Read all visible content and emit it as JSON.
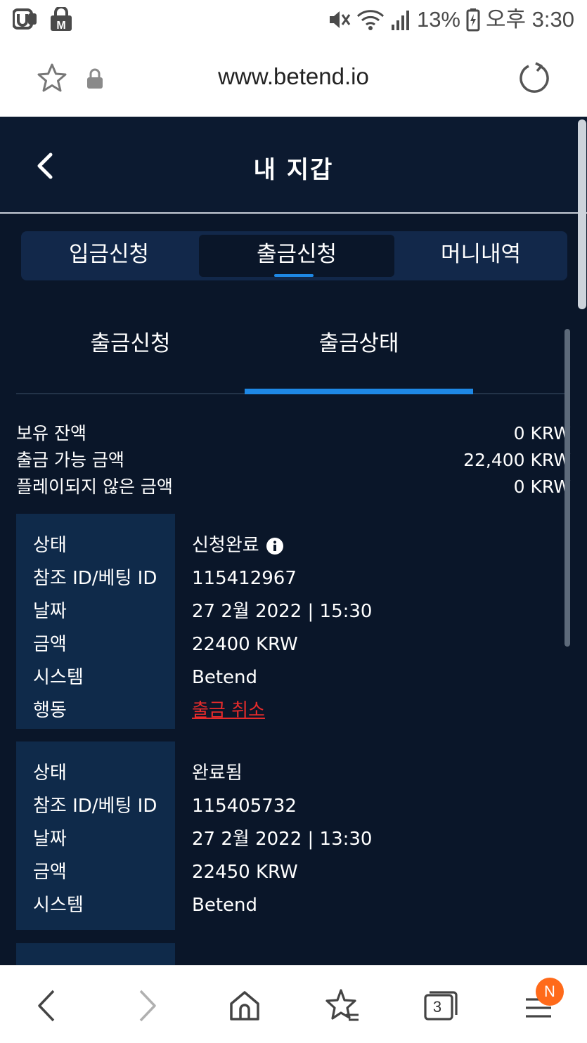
{
  "status_bar": {
    "battery": "13%",
    "time": "오후 3:30"
  },
  "browser": {
    "url": "www.betend.io",
    "tabs_count": "3",
    "menu_badge": "N"
  },
  "header": {
    "title": "내 지갑"
  },
  "main_tabs": [
    {
      "label": "입금신청"
    },
    {
      "label": "출금신청"
    },
    {
      "label": "머니내역"
    }
  ],
  "sub_tabs": [
    {
      "label": "출금신청"
    },
    {
      "label": "출금상태"
    }
  ],
  "balance": [
    {
      "label": "보유 잔액",
      "value": "0 KRW"
    },
    {
      "label": "출금 가능 금액",
      "value": "22,400 KRW"
    },
    {
      "label": "플레이되지 않은 금액",
      "value": "0 KRW"
    }
  ],
  "withdrawals": [
    {
      "status_label": "상태",
      "status": "신청완료",
      "ref_label": "참조 ID/베팅 ID",
      "ref": "115412967",
      "date_label": "날짜",
      "date": "27 2월 2022 | 15:30",
      "amount_label": "금액",
      "amount": "22400 KRW",
      "system_label": "시스템",
      "system": "Betend",
      "action_label": "행동",
      "action": "출금 취소"
    },
    {
      "status_label": "상태",
      "status": "완료됨",
      "ref_label": "참조 ID/베팅 ID",
      "ref": "115405732",
      "date_label": "날짜",
      "date": "27 2월 2022 | 13:30",
      "amount_label": "금액",
      "amount": "22450 KRW",
      "system_label": "시스템",
      "system": "Betend"
    }
  ],
  "colors": {
    "app_bg": "#0a1629",
    "card_bg": "#0f2a4a",
    "accent": "#1e88e5",
    "cancel": "#e52b2b",
    "badge": "#ff6a1a"
  }
}
